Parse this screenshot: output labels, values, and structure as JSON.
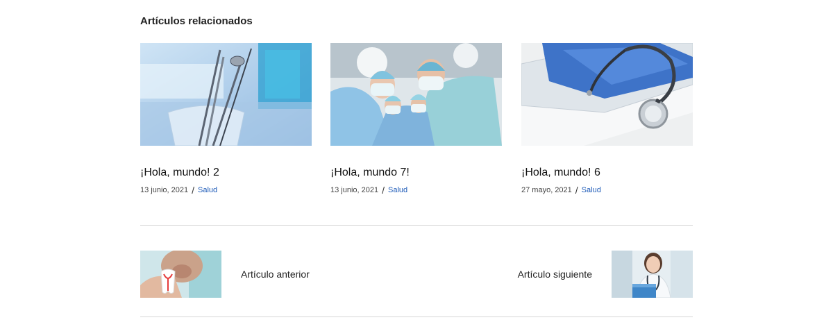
{
  "related": {
    "heading": "Artículos relacionados",
    "posts": [
      {
        "title": "¡Hola, mundo! 2",
        "date": "13 junio, 2021",
        "separator": "/",
        "category": "Salud",
        "image": "dental-instruments-image"
      },
      {
        "title": "¡Hola, mundo 7!",
        "date": "13 junio, 2021",
        "separator": "/",
        "category": "Salud",
        "image": "surgeons-image"
      },
      {
        "title": "¡Hola, mundo! 6",
        "date": "27 mayo, 2021",
        "separator": "/",
        "category": "Salud",
        "image": "stethoscope-image"
      }
    ]
  },
  "post_nav": {
    "previous_label": "Artículo anterior",
    "previous_image": "tooth-model-image",
    "next_label": "Artículo siguiente",
    "next_image": "doctor-woman-image"
  },
  "colors": {
    "link": "#1e5bb8",
    "divider": "#d6d6d6"
  }
}
